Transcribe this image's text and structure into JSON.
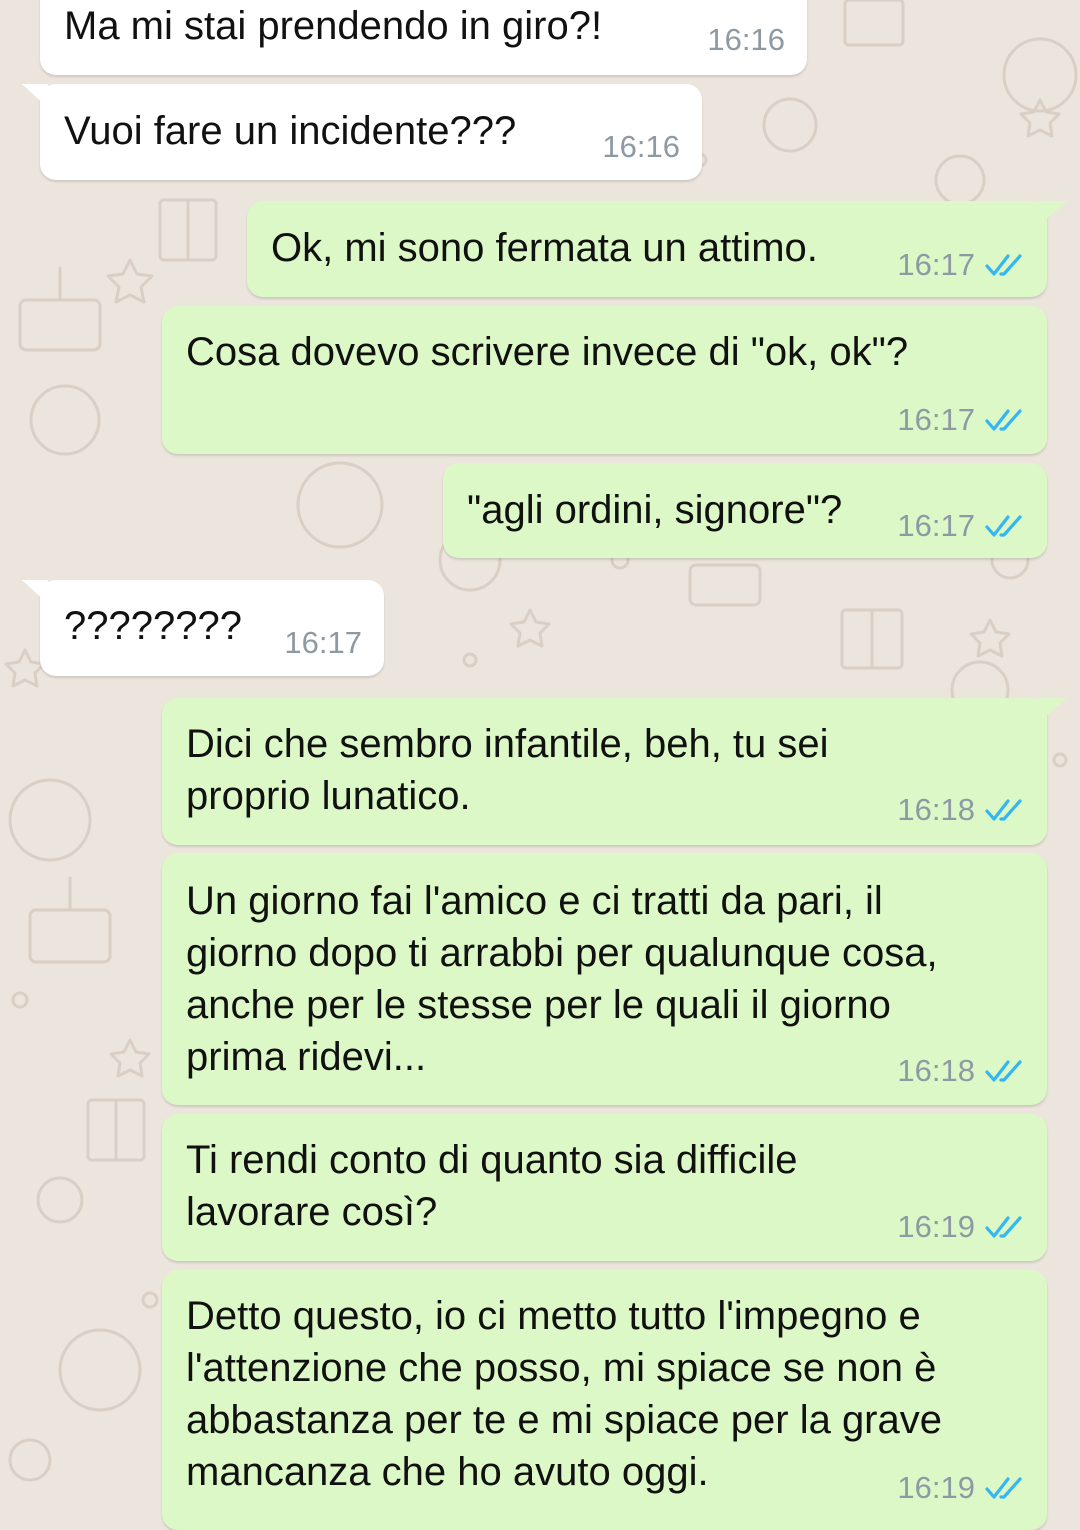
{
  "colors": {
    "background": "#ece5dd",
    "incoming_bubble": "#ffffff",
    "outgoing_bubble": "#dcf8c6",
    "read_ticks": "#34b7f1",
    "timestamp": "#8e9aa3"
  },
  "messages": [
    {
      "direction": "incoming",
      "text": "Ma mi stai prendendo in giro?!",
      "time": "16:16"
    },
    {
      "direction": "incoming",
      "text": "Vuoi fare un incidente???",
      "time": "16:16"
    },
    {
      "direction": "outgoing",
      "text": "Ok, mi sono fermata un attimo.",
      "time": "16:17",
      "status": "read"
    },
    {
      "direction": "outgoing",
      "text": "Cosa dovevo scrivere invece di \"ok, ok\"?",
      "time": "16:17",
      "status": "read"
    },
    {
      "direction": "outgoing",
      "text": "\"agli ordini, signore\"?",
      "time": "16:17",
      "status": "read"
    },
    {
      "direction": "incoming",
      "text": "????????",
      "time": "16:17"
    },
    {
      "direction": "outgoing",
      "text": "Dici che sembro infantile, beh, tu sei\nproprio lunatico.",
      "time": "16:18",
      "status": "read"
    },
    {
      "direction": "outgoing",
      "text": "Un giorno fai l'amico e ci tratti da pari, il\ngiorno dopo ti arrabbi per qualunque cosa,\nanche per le stesse per le quali il giorno\nprima ridevi...",
      "time": "16:18",
      "status": "read"
    },
    {
      "direction": "outgoing",
      "text": "Ti rendi conto di quanto sia difficile\nlavorare così?",
      "time": "16:19",
      "status": "read"
    },
    {
      "direction": "outgoing",
      "text": "Detto questo, io ci metto tutto l'impegno e\nl'attenzione che posso, mi spiace se non è\nabbastanza per te e mi spiace per la grave\nmancanza che ho avuto oggi.",
      "time": "16:19",
      "status": "read"
    }
  ]
}
